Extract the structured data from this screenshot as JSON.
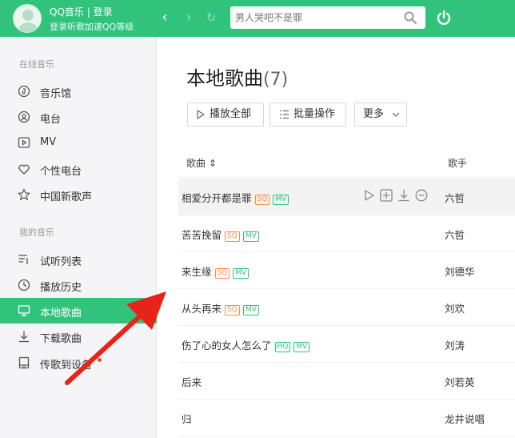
{
  "header": {
    "user_title": "QQ音乐 | 登录",
    "user_subtitle": "登录听歌加速QQ等级",
    "nav_back": "‹",
    "nav_forward": "›",
    "nav_refresh": "↻",
    "search_placeholder": "男人哭吧不是罪",
    "accent_color": "#31c27c"
  },
  "sidebar": {
    "online_section": "在线音乐",
    "online_items": [
      {
        "label": "音乐馆",
        "icon": "music-hall-icon"
      },
      {
        "label": "电台",
        "icon": "radio-icon"
      },
      {
        "label": "MV",
        "icon": "mv-icon"
      },
      {
        "label": "个性电台",
        "icon": "heart-icon"
      },
      {
        "label": "中国新歌声",
        "icon": "star-icon"
      }
    ],
    "my_section": "我的音乐",
    "my_items": [
      {
        "label": "试听列表",
        "icon": "playlist-icon"
      },
      {
        "label": "播放历史",
        "icon": "clock-icon"
      },
      {
        "label": "本地歌曲",
        "icon": "monitor-icon",
        "active": true
      },
      {
        "label": "下载歌曲",
        "icon": "download-icon"
      },
      {
        "label": "传歌到设备",
        "icon": "device-icon"
      }
    ]
  },
  "main": {
    "title": "本地歌曲",
    "count": "(7)",
    "play_all": "播放全部",
    "batch": "批量操作",
    "more": "更多",
    "col_song": "歌曲 ⇕",
    "col_artist": "歌手",
    "songs": [
      {
        "title": "相爱分开都是罪",
        "badge1": "SQ",
        "badge1_type": "sq",
        "badge2": "MV",
        "artist": "六哲"
      },
      {
        "title": "苦苦挽留",
        "badge1": "SQ",
        "badge1_type": "sq",
        "badge2": "MV",
        "artist": "六哲"
      },
      {
        "title": "来生缘",
        "badge1": "SQ",
        "badge1_type": "sq",
        "badge2": "MV",
        "artist": "刘德华"
      },
      {
        "title": "从头再来",
        "badge1": "SQ",
        "badge1_type": "sq",
        "badge2": "MV",
        "artist": "刘欢"
      },
      {
        "title": "伤了心的女人怎么了",
        "badge1": "HQ",
        "badge1_type": "hq",
        "badge2": "MV",
        "artist": "刘涛"
      },
      {
        "title": "后来",
        "badge1": "",
        "badge1_type": "",
        "badge2": "",
        "artist": "刘若英"
      },
      {
        "title": "归",
        "badge1": "",
        "badge1_type": "",
        "badge2": "",
        "artist": "龙井说唱"
      }
    ]
  },
  "annotation": {
    "arrow_color": "#e8231a"
  }
}
